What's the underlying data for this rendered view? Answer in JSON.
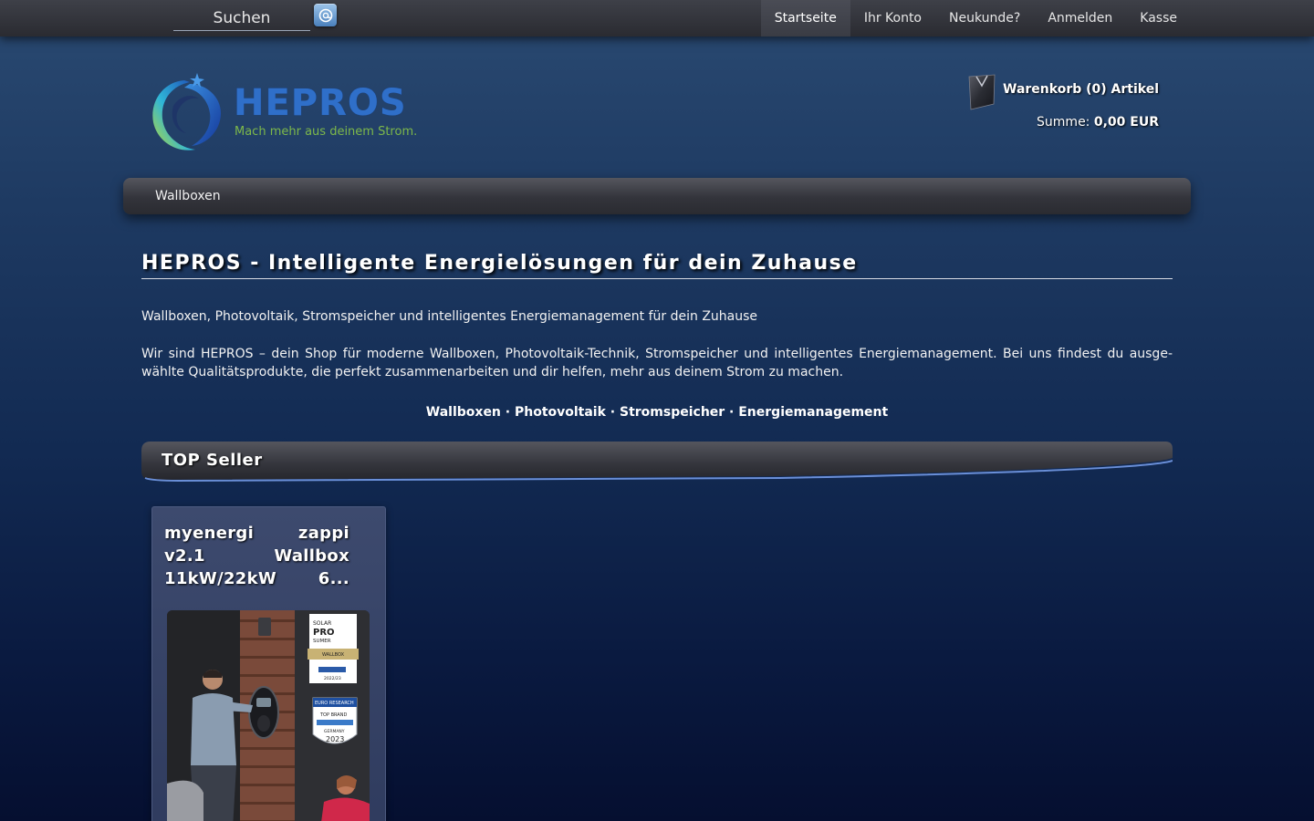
{
  "topbar": {
    "search": {
      "placeholder": "Suchen",
      "value": ""
    },
    "nav": [
      {
        "label": "Startseite",
        "active": true
      },
      {
        "label": "Ihr Konto",
        "active": false
      },
      {
        "label": "Neukunde?",
        "active": false
      },
      {
        "label": "Anmelden",
        "active": false
      },
      {
        "label": "Kasse",
        "active": false
      }
    ]
  },
  "header": {
    "logo": {
      "name": "HEPROS",
      "tagline": "Mach mehr aus deinem Strom."
    },
    "cart": {
      "title": "Warenkorb (0) Artikel",
      "sum_label": "Summe:",
      "sum_value": "0,00 EUR"
    }
  },
  "categories": [
    {
      "label": "Wallboxen"
    }
  ],
  "main": {
    "title": "HEPROS - Intelligente Energielösungen für dein Zuhause",
    "subline": "Wallboxen, Photovoltaik, Stromspeicher und intelligentes Energiemanagement für dein Zuhause",
    "intro": "Wir sind HEPROS – dein Shop für moderne Wallboxen, Photovoltaik-Technik, Stromspeicher und intelligentes Energiemanagement. Bei uns findest du ausge­wählte Qualitätsprodukte, die perfekt zusammenarbeiten und dir helfen, mehr aus deinem Strom zu machen.",
    "keywords": "Wallboxen · Photovoltaik · Stromspeicher · Energiemanagement",
    "section_title": "TOP Seller",
    "products": [
      {
        "name": "myenergi zappi v2.1 Wallbox 11kW/22kW 6...",
        "badges": {
          "award1": [
            "SOLAR",
            "PRO",
            "SUMER",
            "WALLBOX",
            "2022/23"
          ],
          "award2": [
            "EURO RESEARCH",
            "TOP BRAND",
            "GERMANY",
            "2023"
          ]
        }
      }
    ]
  },
  "colors": {
    "accent": "#2f6fc9",
    "tagline": "#7db84a",
    "topbar": "#33353c"
  },
  "icons": {
    "search": "search-icon",
    "cart": "shopping-bag-icon",
    "logo": "logo-swirl-icon"
  }
}
